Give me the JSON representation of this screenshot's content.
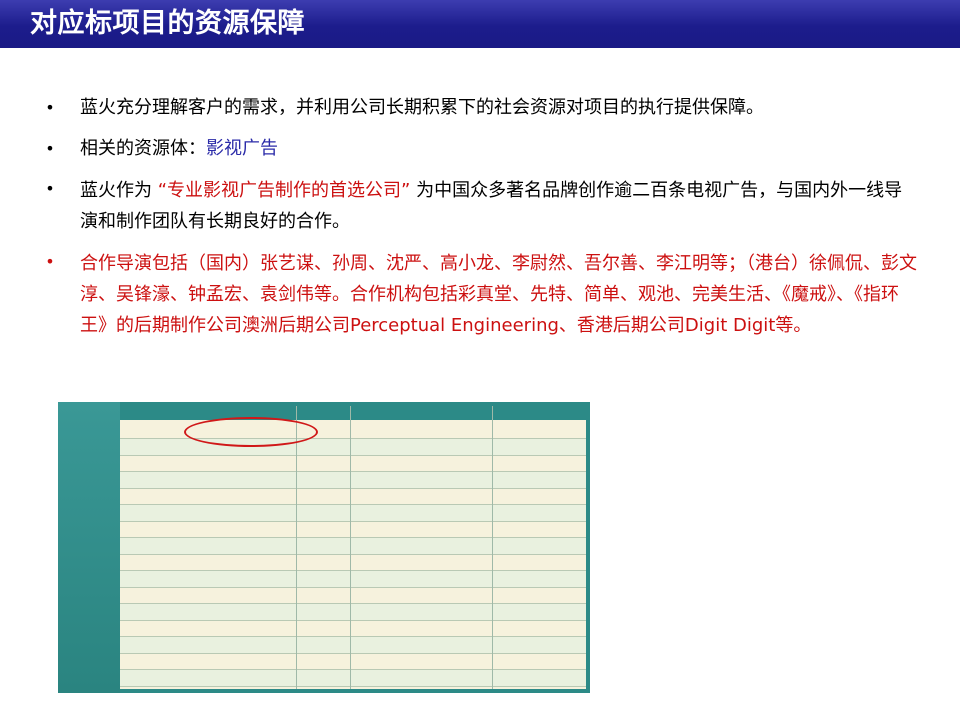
{
  "title": "对应标项目的资源保障",
  "bullets": [
    {
      "text": "蓝火充分理解客户的需求，并利用公司长期积累下的社会资源对项目的执行提供保障。"
    },
    {
      "prefix": "相关的资源体：",
      "highlight": "影视广告"
    },
    {
      "prefix": "蓝火作为 ",
      "highlight": "“专业影视广告制作的首选公司”",
      "suffix": " 为中国众多著名品牌创作逾二百条电视广告，与国内外一线导演和制作团队有长期良好的合作。"
    },
    {
      "text": "合作导演包括（国内）张艺谋、孙周、沈严、高小龙、李尉然、吾尔善、李江明等；（港台）徐佩侃、彭文淳、吴锋濠、钟孟宏、袁剑伟等。合作机构包括彩真堂、先特、简单、观池、完美生活、《魔戒》、《指环王》的后期制作公司澳洲后期公司Perceptual Engineering、香港后期公司Digit Digit等。"
    }
  ],
  "colors": {
    "title_bar": "#1c1c8c",
    "accent_blue": "#2a2aa8",
    "accent_red": "#cc1010",
    "table_teal": "#2c8a87"
  }
}
